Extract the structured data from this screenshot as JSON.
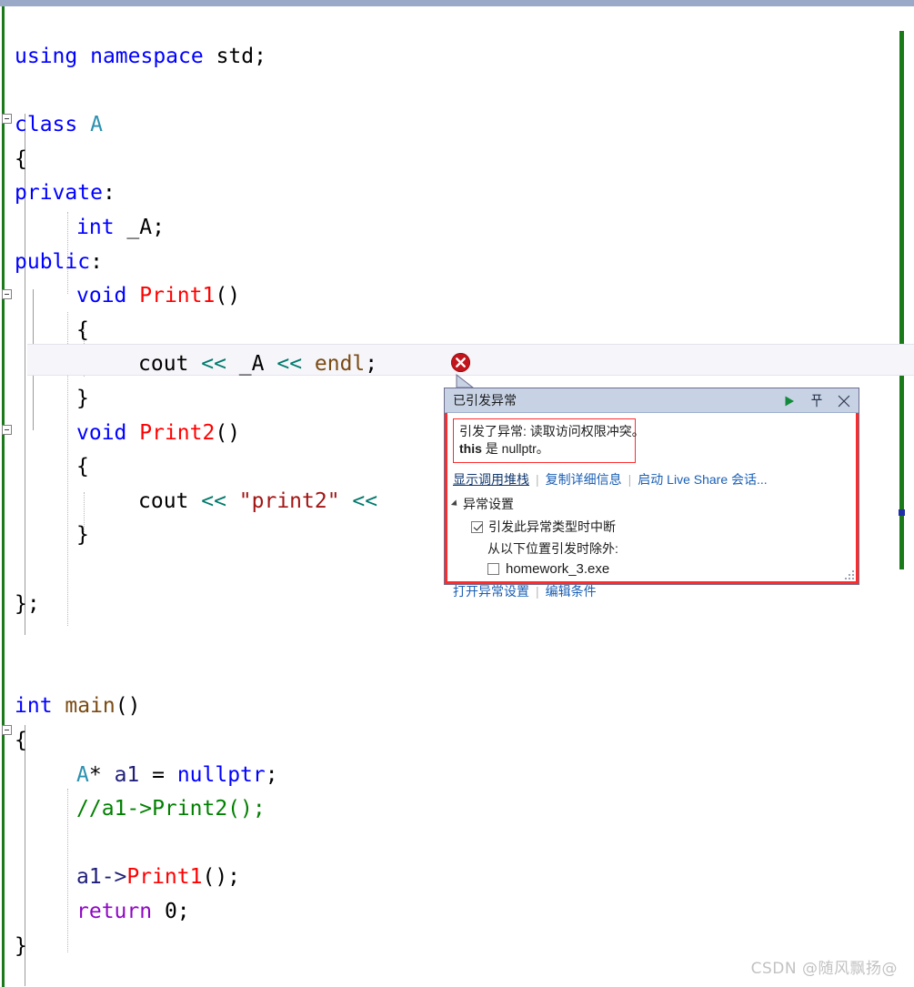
{
  "editor": {
    "lines": [
      {
        "indent": 0,
        "tokens": [
          {
            "t": "using ",
            "c": "k"
          },
          {
            "t": "namespace ",
            "c": "k"
          },
          {
            "t": "std;",
            "c": "pl"
          }
        ]
      },
      {
        "indent": 0,
        "tokens": []
      },
      {
        "indent": 0,
        "tokens": [
          {
            "t": "class ",
            "c": "k"
          },
          {
            "t": "A",
            "c": "ty"
          }
        ]
      },
      {
        "indent": 0,
        "tokens": [
          {
            "t": "{",
            "c": "pl"
          }
        ]
      },
      {
        "indent": 0,
        "tokens": [
          {
            "t": "private",
            "c": "k"
          },
          {
            "t": ":",
            "c": "pl"
          }
        ]
      },
      {
        "indent": 1,
        "tokens": [
          {
            "t": "int ",
            "c": "k"
          },
          {
            "t": "_A;",
            "c": "pl"
          }
        ]
      },
      {
        "indent": 0,
        "tokens": [
          {
            "t": "public",
            "c": "k"
          },
          {
            "t": ":",
            "c": "pl"
          }
        ]
      },
      {
        "indent": 1,
        "tokens": [
          {
            "t": "void ",
            "c": "k"
          },
          {
            "t": "Print1",
            "c": "fn"
          },
          {
            "t": "()",
            "c": "pl"
          }
        ]
      },
      {
        "indent": 1,
        "tokens": [
          {
            "t": "{",
            "c": "pl"
          }
        ]
      },
      {
        "indent": 2,
        "tokens": [
          {
            "t": "cout ",
            "c": "pl"
          },
          {
            "t": "<< ",
            "c": "op"
          },
          {
            "t": "_A ",
            "c": "pl"
          },
          {
            "t": "<< ",
            "c": "op"
          },
          {
            "t": "endl",
            "c": "pn"
          },
          {
            "t": ";",
            "c": "pl"
          }
        ]
      },
      {
        "indent": 1,
        "tokens": [
          {
            "t": "}",
            "c": "pl"
          }
        ]
      },
      {
        "indent": 1,
        "tokens": [
          {
            "t": "void ",
            "c": "k"
          },
          {
            "t": "Print2",
            "c": "fn"
          },
          {
            "t": "()",
            "c": "pl"
          }
        ]
      },
      {
        "indent": 1,
        "tokens": [
          {
            "t": "{",
            "c": "pl"
          }
        ]
      },
      {
        "indent": 2,
        "tokens": [
          {
            "t": "cout ",
            "c": "pl"
          },
          {
            "t": "<< ",
            "c": "op"
          },
          {
            "t": "\"print2\" ",
            "c": "st"
          },
          {
            "t": "<< ",
            "c": "op"
          }
        ]
      },
      {
        "indent": 1,
        "tokens": [
          {
            "t": "}",
            "c": "pl"
          }
        ]
      },
      {
        "indent": 0,
        "tokens": []
      },
      {
        "indent": 0,
        "tokens": [
          {
            "t": "};",
            "c": "pl"
          }
        ]
      },
      {
        "indent": 0,
        "tokens": []
      },
      {
        "indent": 0,
        "tokens": []
      },
      {
        "indent": 0,
        "tokens": [
          {
            "t": "int ",
            "c": "k"
          },
          {
            "t": "main",
            "c": "pn"
          },
          {
            "t": "()",
            "c": "pl"
          }
        ]
      },
      {
        "indent": 0,
        "tokens": [
          {
            "t": "{",
            "c": "pl"
          }
        ]
      },
      {
        "indent": 1,
        "tokens": [
          {
            "t": "A",
            "c": "ty"
          },
          {
            "t": "* ",
            "c": "pl"
          },
          {
            "t": "a1 ",
            "c": "id"
          },
          {
            "t": "= ",
            "c": "pl"
          },
          {
            "t": "nullptr",
            "c": "k"
          },
          {
            "t": ";",
            "c": "pl"
          }
        ]
      },
      {
        "indent": 1,
        "tokens": [
          {
            "t": "//a1->Print2();",
            "c": "cm"
          }
        ]
      },
      {
        "indent": 0,
        "tokens": []
      },
      {
        "indent": 1,
        "tokens": [
          {
            "t": "a1->",
            "c": "id"
          },
          {
            "t": "Print1",
            "c": "fn"
          },
          {
            "t": "();",
            "c": "pl"
          }
        ]
      },
      {
        "indent": 1,
        "tokens": [
          {
            "t": "return ",
            "c": "kw2"
          },
          {
            "t": "0;",
            "c": "pl"
          }
        ]
      },
      {
        "indent": 0,
        "tokens": [
          {
            "t": "}",
            "c": "pl"
          }
        ]
      }
    ],
    "error_marker_label": "error-circle-x"
  },
  "exception_popup": {
    "title": "已引发异常",
    "titlebar_buttons": [
      {
        "name": "continue-button",
        "icon": "play-triangle-icon"
      },
      {
        "name": "pin-button",
        "icon": "pin-icon"
      },
      {
        "name": "close-button",
        "icon": "close-x-icon"
      }
    ],
    "message": {
      "line1": "引发了异常: 读取访问权限冲突。",
      "line2_bold": "this",
      "line2_rest": " 是 nullptr。"
    },
    "links": {
      "show_call_stack": "显示调用堆栈",
      "copy_details": "复制详细信息",
      "live_share": "启动 Live Share 会话..."
    },
    "settings": {
      "header": "异常设置",
      "break_checkbox_label": "引发此异常类型时中断",
      "break_checkbox_checked": true,
      "except_when_label": "从以下位置引发时除外:",
      "module_checkbox_label": "homework_3.exe",
      "module_checkbox_checked": false,
      "open_settings_link": "打开异常设置",
      "edit_conditions_link": "编辑条件"
    }
  },
  "watermark": "CSDN @随风飘扬@",
  "colors": {
    "keyword": "#0000ff",
    "type": "#2b91af",
    "function": "#ff0000",
    "string": "#a31515",
    "comment": "#008000",
    "operator": "#00796b",
    "error_red": "#c3161c",
    "popup_border_red": "#ff2b2b",
    "titlebar": "#c7d2e5",
    "change_marker_green": "#1a7a1a",
    "top_bar": "#9aa9c7"
  }
}
